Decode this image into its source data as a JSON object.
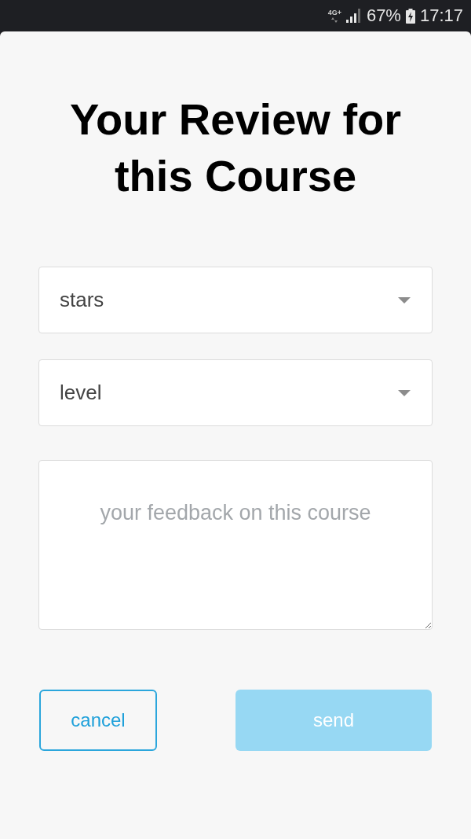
{
  "status_bar": {
    "network": "4G+",
    "battery": "67%",
    "time": "17:17"
  },
  "title": "Your Review for this Course",
  "dropdowns": [
    {
      "value": "stars"
    },
    {
      "value": "level"
    }
  ],
  "feedback": {
    "placeholder": "your feedback on this course"
  },
  "buttons": [
    {
      "label": "cancel",
      "kind": "outline",
      "disabled": false
    },
    {
      "label": "send",
      "kind": "filled",
      "disabled": true
    }
  ]
}
